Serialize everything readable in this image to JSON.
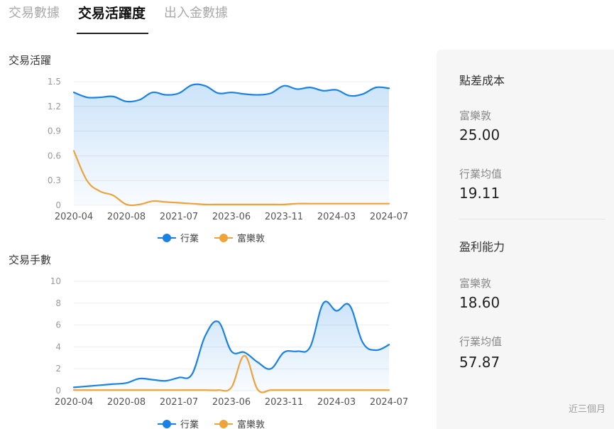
{
  "tabs": [
    {
      "label": "交易數據",
      "active": false
    },
    {
      "label": "交易活躍度",
      "active": true
    },
    {
      "label": "出入金數據",
      "active": false
    }
  ],
  "colors": {
    "industry": "#1a82e6",
    "futu": "#eea33b",
    "grid": "#ededed",
    "axis_text": "#888888"
  },
  "chart_data": [
    {
      "type": "area",
      "title": "交易活躍",
      "x_labels": [
        "2020-04",
        "2020-08",
        "2021-07",
        "2023-06",
        "2023-11",
        "2024-03",
        "2024-07"
      ],
      "ylim": [
        0,
        1.5
      ],
      "y_ticks": [
        "0",
        "0.3",
        "0.6",
        "0.9",
        "1.2",
        "1.5"
      ],
      "grid": true,
      "legend_position": "bottom",
      "series": [
        {
          "name": "行業",
          "color": "#1a82e6",
          "values": [
            1.37,
            1.31,
            1.31,
            1.32,
            1.26,
            1.28,
            1.37,
            1.34,
            1.36,
            1.46,
            1.45,
            1.36,
            1.37,
            1.35,
            1.34,
            1.36,
            1.45,
            1.41,
            1.43,
            1.39,
            1.4,
            1.33,
            1.35,
            1.43,
            1.42
          ]
        },
        {
          "name": "富樂敦",
          "color": "#eea33b",
          "values": [
            0.66,
            0.3,
            0.17,
            0.12,
            0.01,
            0.01,
            0.05,
            0.04,
            0.03,
            0.02,
            0.01,
            0.01,
            0.01,
            0.01,
            0.01,
            0.01,
            0.01,
            0.02,
            0.02,
            0.02,
            0.02,
            0.02,
            0.02,
            0.02,
            0.02
          ]
        }
      ]
    },
    {
      "type": "area",
      "title": "交易手數",
      "x_labels": [
        "2020-04",
        "2020-08",
        "2021-07",
        "2023-06",
        "2023-11",
        "2024-03",
        "2024-07"
      ],
      "ylim": [
        0,
        10
      ],
      "y_ticks": [
        "0",
        "2",
        "4",
        "6",
        "8",
        "10"
      ],
      "grid": true,
      "legend_position": "bottom",
      "series": [
        {
          "name": "行業",
          "color": "#1a82e6",
          "values": [
            0.3,
            0.4,
            0.5,
            0.6,
            0.7,
            1.1,
            1.0,
            0.9,
            1.2,
            1.5,
            5.0,
            6.3,
            3.6,
            3.5,
            2.6,
            2.0,
            3.5,
            3.6,
            4.0,
            8.0,
            7.3,
            7.8,
            4.4,
            3.7,
            4.2
          ]
        },
        {
          "name": "富樂敦",
          "color": "#eea33b",
          "values": [
            0.05,
            0.05,
            0.05,
            0.05,
            0.05,
            0.05,
            0.05,
            0.05,
            0.05,
            0.05,
            0.05,
            0.05,
            0.3,
            3.2,
            0.1,
            0.05,
            0.05,
            0.05,
            0.05,
            0.05,
            0.05,
            0.05,
            0.05,
            0.05,
            0.05
          ]
        }
      ]
    }
  ],
  "panel": {
    "spread_cost": {
      "title": "點差成本",
      "futu_label": "富樂敦",
      "futu_value": "25.00",
      "industry_label": "行業均值",
      "industry_value": "19.11"
    },
    "profitability": {
      "title": "盈利能力",
      "futu_label": "富樂敦",
      "futu_value": "18.60",
      "industry_label": "行業均值",
      "industry_value": "57.87"
    },
    "note": "近三個月"
  }
}
